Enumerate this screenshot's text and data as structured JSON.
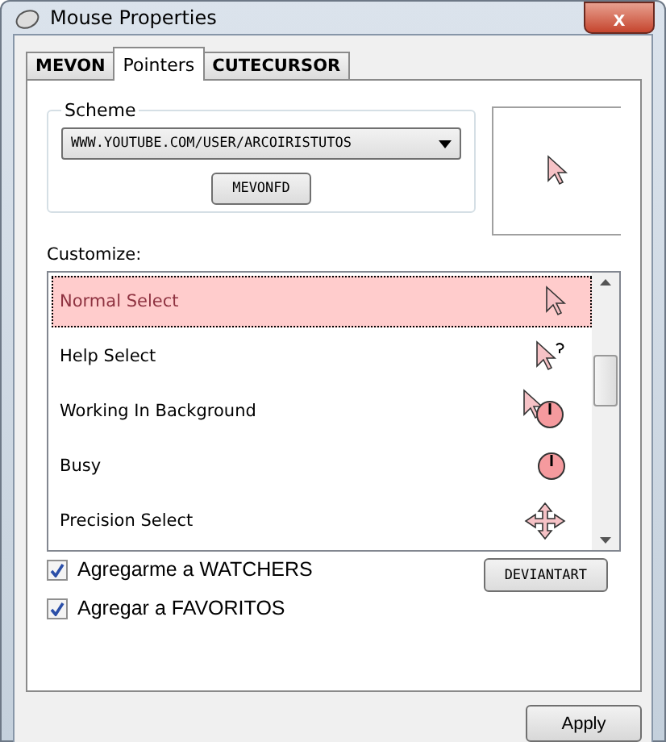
{
  "window": {
    "title": "Mouse Properties",
    "close": "x"
  },
  "tabs": [
    {
      "label": "MEVON",
      "selected": false
    },
    {
      "label": "Pointers",
      "selected": true
    },
    {
      "label": "CUTECURSOR",
      "selected": false
    }
  ],
  "scheme": {
    "label": "Scheme",
    "value": "WWW.YOUTUBE.COM/USER/ARCOIRISTUTOS",
    "button": "MEVONFD"
  },
  "customize": {
    "label": "Customize:",
    "items": [
      {
        "label": "Normal Select",
        "kind": "arrow",
        "selected": true
      },
      {
        "label": "Help Select",
        "kind": "help",
        "selected": false
      },
      {
        "label": "Working In Background",
        "kind": "working",
        "selected": false
      },
      {
        "label": "Busy",
        "kind": "busy",
        "selected": false
      },
      {
        "label": "Precision Select",
        "kind": "move",
        "selected": false
      }
    ]
  },
  "checkboxes": [
    {
      "label": "Agregarme a WATCHERS",
      "checked": true
    },
    {
      "label": "Agregar a FAVORITOS",
      "checked": true
    }
  ],
  "side_button": "DEVIANTART",
  "apply": "Apply"
}
